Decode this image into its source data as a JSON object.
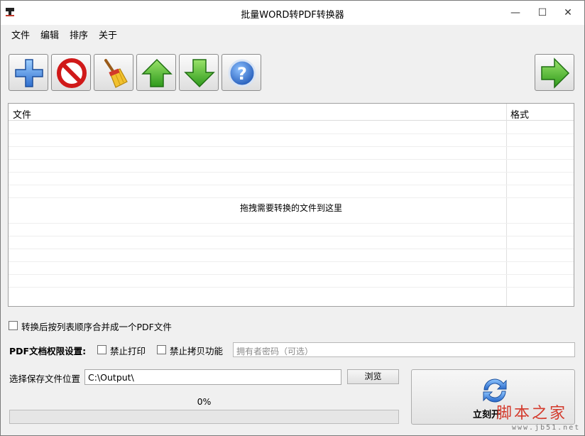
{
  "window": {
    "title": "批量WORD转PDF转换器",
    "minimize_glyph": "—",
    "maximize_glyph": "☐",
    "close_glyph": "✕"
  },
  "menu": [
    "文件",
    "编辑",
    "排序",
    "关于"
  ],
  "toolbar": {
    "buttons": [
      {
        "name": "add-icon"
      },
      {
        "name": "remove-icon"
      },
      {
        "name": "clear-broom-icon"
      },
      {
        "name": "move-up-icon"
      },
      {
        "name": "move-down-icon"
      },
      {
        "name": "help-icon"
      },
      {
        "name": "next-arrow-icon"
      }
    ]
  },
  "file_list": {
    "columns": [
      "文件",
      "格式"
    ],
    "drop_hint": "拖拽需要转换的文件到这里",
    "rows": []
  },
  "options": {
    "merge_label": "转换后按列表顺序合并成一个PDF文件",
    "merge_checked": false,
    "permissions_label": "PDF文档权限设置:",
    "no_print_label": "禁止打印",
    "no_print_checked": false,
    "no_copy_label": "禁止拷贝功能",
    "no_copy_checked": false,
    "owner_password_placeholder": "拥有者密码（可选）"
  },
  "output": {
    "label": "选择保存文件位置",
    "path": "C:\\Output\\",
    "browse_label": "浏览"
  },
  "progress": {
    "percent_text": "0%",
    "value": 0
  },
  "convert": {
    "label": "立刻开"
  },
  "watermark": {
    "text": "脚本之家",
    "url": "www.jb51.net"
  },
  "colors": {
    "accent_green": "#3fae29",
    "accent_blue": "#3a7ed8",
    "watermark_red": "#d43a2c"
  }
}
